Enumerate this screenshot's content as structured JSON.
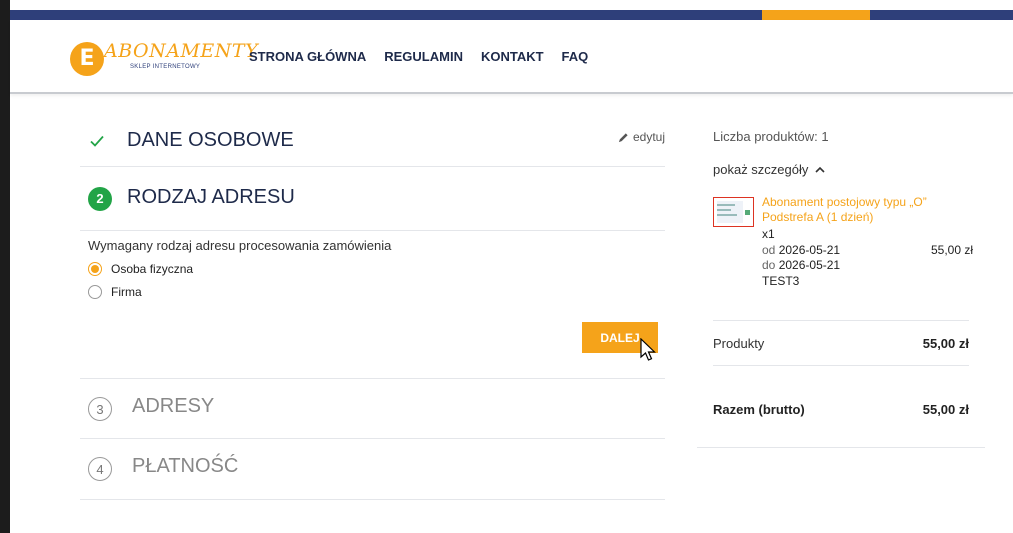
{
  "brand": {
    "logo_letter": "E",
    "logo_name": "ABONAMENTY",
    "logo_tagline": "SKLEP INTERNETOWY",
    "accent_color": "#f5a31a",
    "nav_color": "#2e3f7a",
    "success_color": "#22a447"
  },
  "nav": {
    "items": [
      "STRONA GŁÓWNA",
      "REGULAMIN",
      "KONTAKT",
      "FAQ"
    ]
  },
  "checkout": {
    "step1": {
      "title": "DANE OSOBOWE",
      "edit_label": "edytuj",
      "icon": "check-icon"
    },
    "step2": {
      "number": "2",
      "title": "RODZAJ ADRESU",
      "question": "Wymagany rodzaj adresu procesowania zamówienia",
      "options": [
        {
          "label": "Osoba fizyczna",
          "selected": true
        },
        {
          "label": "Firma",
          "selected": false
        }
      ],
      "next_button": "DALEJ"
    },
    "step3": {
      "number": "3",
      "title": "ADRESY"
    },
    "step4": {
      "number": "4",
      "title": "PŁATNOŚĆ"
    }
  },
  "summary": {
    "count_label": "Liczba produktów: 1",
    "toggle_label": "pokaż szczegóły",
    "product": {
      "name": "Abonament postojowy typu „O” Podstrefa A (1 dzień)",
      "qty": "x1",
      "from_label": "od",
      "from_date": "2026-05-21",
      "to_label": "do",
      "to_date": "2026-05-21",
      "code": "TEST3",
      "price": "55,00 zł"
    },
    "products_label": "Produkty",
    "products_value": "55,00 zł",
    "total_label": "Razem (brutto)",
    "total_value": "55,00 zł"
  }
}
